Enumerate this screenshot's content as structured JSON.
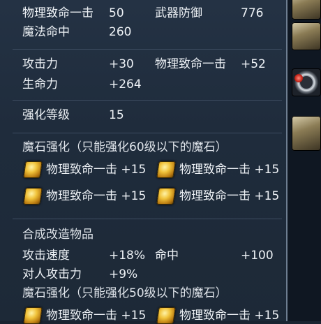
{
  "stats_top": {
    "phys_crit_label": "物理致命一击",
    "phys_crit_value": "50",
    "weapon_def_label": "武器防御",
    "weapon_def_value": "776",
    "magic_acc_label": "魔法命中",
    "magic_acc_value": "260"
  },
  "bonus": {
    "attack_label": "攻击力",
    "attack_value": "+30",
    "phys_crit_label": "物理致命一击",
    "phys_crit_value": "+52",
    "hp_label": "生命力",
    "hp_value": "+264"
  },
  "enchant": {
    "label": "强化等级",
    "value": "15"
  },
  "manastone_60": {
    "header": "魔石强化（只能强化60级以下的魔石）",
    "slots": [
      {
        "text": "物理致命一击 +15"
      },
      {
        "text": "物理致命一击 +15"
      },
      {
        "text": "物理致命一击 +15"
      },
      {
        "text": "物理致命一击 +15"
      }
    ]
  },
  "fusion": {
    "header": "合成改造物品",
    "atk_speed_label": "攻击速度",
    "atk_speed_value": "+18%",
    "accuracy_label": "命中",
    "accuracy_value": "+100",
    "pvp_atk_label": "对人攻击力",
    "pvp_atk_value": "+9%"
  },
  "manastone_50": {
    "header": "魔石强化（只能强化50级以下的魔石）",
    "slots": [
      {
        "text": "物理致命一击 +15"
      },
      {
        "text": "物理致命一击 +15"
      }
    ]
  },
  "colors": {
    "panel_bg": "#1f2c3c",
    "text": "#eef2f6",
    "manastone": "#f0c23a"
  },
  "icons": {
    "manastone": "manastone-icon",
    "sidebar": [
      "armor-icon",
      "armor-icon",
      "ring-icon",
      "armor-icon"
    ]
  }
}
